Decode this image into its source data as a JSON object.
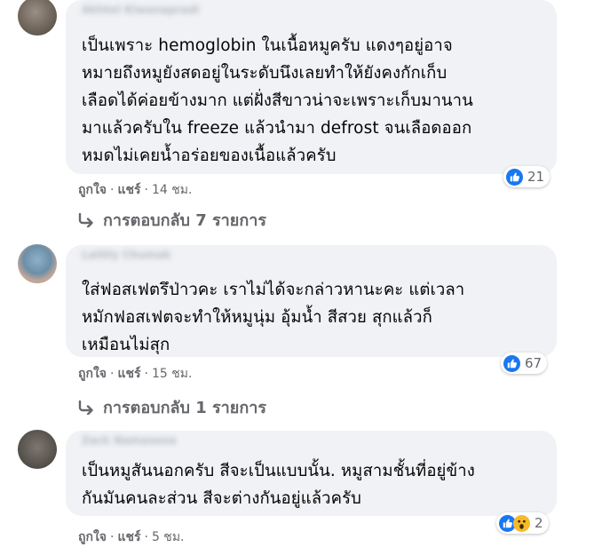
{
  "comments": [
    {
      "author": "Akhtel Kiwanapradi",
      "lines": [
        "เป็นเพราะ hemoglobin ในเนื้อหมูครับ แดงๆอยู่อาจ",
        "หมายถึงหมูยังสดอยู่ในระดับนึงเลยทำให้ยังคงกักเก็บ",
        "เลือดได้ค่อยข้างมาก แต่ฝั่งสีขาวน่าจะเพราะเก็บมานาน",
        "มาแล้วครับใน freeze แล้วนำมา defrost จนเลือดออก",
        "หมดไม่เคยน้ำอร่อยของเนื้อแล้วครับ"
      ],
      "reaction_icons": [
        "like-icon"
      ],
      "reaction_count": "21",
      "like_label": "ถูกใจ",
      "share_label": "แชร์",
      "separator": "·",
      "time": "14 ชม.",
      "replies_label": "การตอบกลับ 7 รายการ"
    },
    {
      "author": "Lalitly Chumak",
      "lines": [
        "ใส่ฟอสเฟตรึป่าวคะ เราไม่ได้จะกล่าวหานะคะ แต่เวลา",
        "หมักฟอสเฟตจะทำให้หมูนุ่ม อุ้มน้ำ สีสวย สุกแล้วก็",
        "เหมือนไม่สุก"
      ],
      "reaction_icons": [
        "like-icon"
      ],
      "reaction_count": "67",
      "like_label": "ถูกใจ",
      "share_label": "แชร์",
      "separator": "·",
      "time": "15 ชม.",
      "replies_label": "การตอบกลับ 1 รายการ"
    },
    {
      "author": "Zack Namasena",
      "lines": [
        "เป็นหมูสันนอกครับ สีจะเป็นแบบนั้น. หมูสามชั้นที่อยู่ข้าง",
        "กันมันคนละส่วน สีจะต่างกันอยู่แล้วครับ"
      ],
      "reaction_icons": [
        "like-icon",
        "wow-icon"
      ],
      "reaction_count": "2",
      "like_label": "ถูกใจ",
      "share_label": "แชร์",
      "separator": "·",
      "time": "5 ชม."
    }
  ],
  "colors": {
    "bubble": "#f0f2f5",
    "secondary_text": "#65676b",
    "like_blue": "#1877f2",
    "wow_yellow": "#f7b928"
  }
}
